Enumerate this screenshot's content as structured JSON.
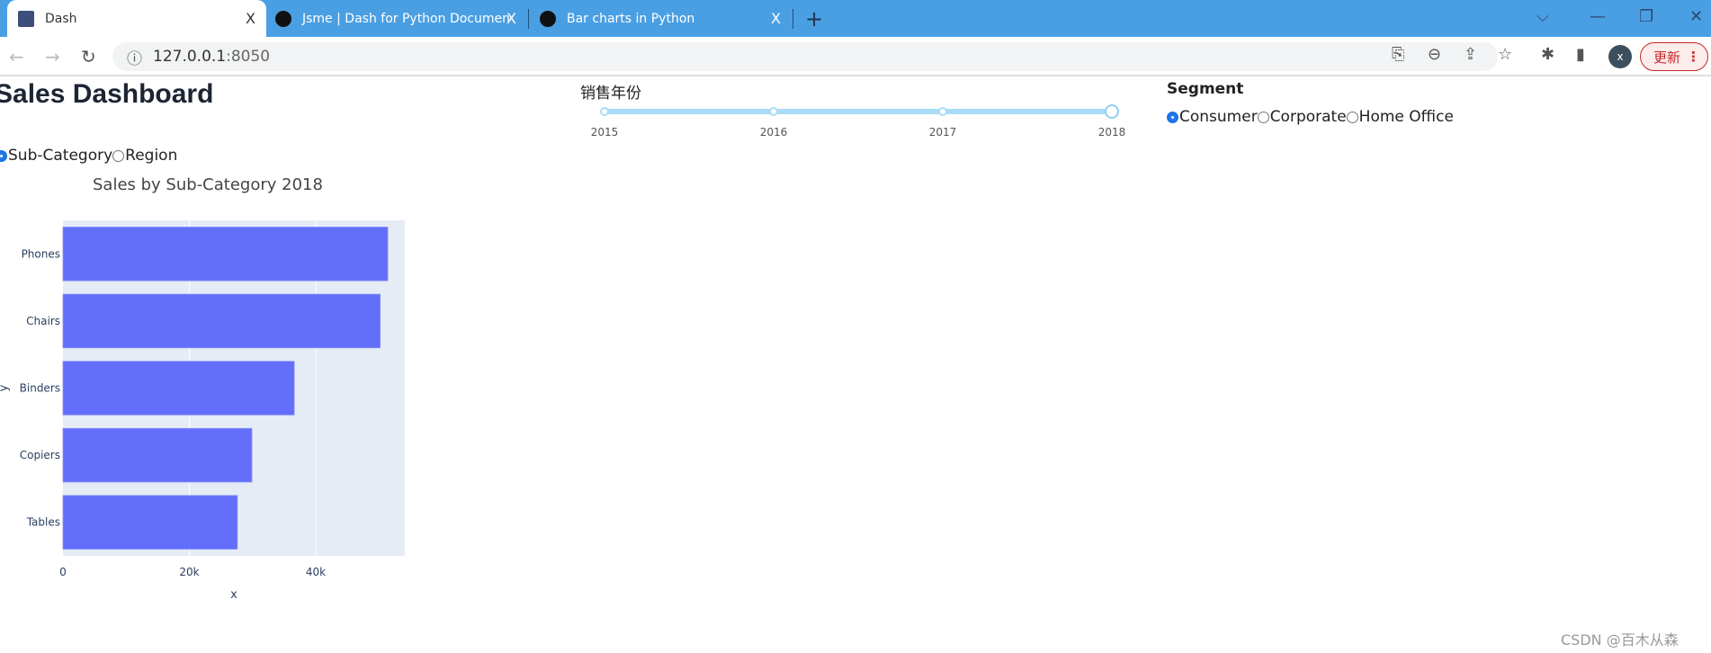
{
  "browser": {
    "tabs": [
      {
        "title": "Dash",
        "close": "X"
      },
      {
        "title": "Jsme | Dash for Python Documen",
        "close": "X"
      },
      {
        "title": "Bar charts in Python",
        "close": "X"
      }
    ],
    "new_tab": "+",
    "url_host": "127.0.0.1",
    "url_port": ":8050",
    "profile": "x",
    "update_label": "更新"
  },
  "page": {
    "title": "Sales Dashboard",
    "group_options": [
      {
        "label": "Sub-Category",
        "selected": true
      },
      {
        "label": "Region",
        "selected": false
      }
    ],
    "slider": {
      "label": "销售年份",
      "marks": [
        "2015",
        "2016",
        "2017",
        "2018"
      ],
      "value": "2018"
    },
    "segment": {
      "label": "Segment",
      "options": [
        {
          "label": "Consumer",
          "selected": true
        },
        {
          "label": "Corporate",
          "selected": false
        },
        {
          "label": "Home Office",
          "selected": false
        }
      ]
    }
  },
  "chart_data": {
    "type": "bar",
    "orientation": "horizontal",
    "title": "Sales by Sub-Category 2018",
    "xlabel": "x",
    "ylabel": "y",
    "categories": [
      "Tables",
      "Copiers",
      "Binders",
      "Chairs",
      "Phones"
    ],
    "values": [
      27600,
      29900,
      36600,
      50200,
      51400
    ],
    "xlim": [
      0,
      54100
    ],
    "xticks": [
      0,
      20000,
      40000
    ],
    "xtick_labels": [
      "0",
      "20k",
      "40k"
    ],
    "bar_color": "#636efa",
    "plot_bg": "#e5ecf6",
    "grid": true
  },
  "watermark": "CSDN @百木从森"
}
